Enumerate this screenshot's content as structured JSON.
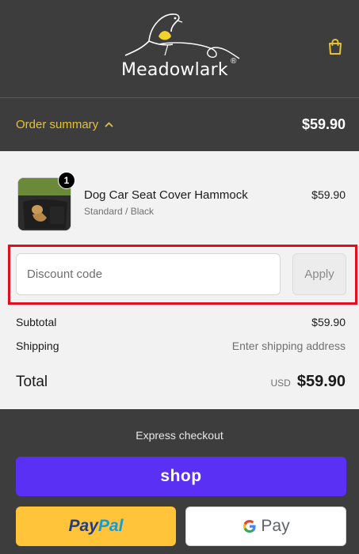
{
  "header": {
    "brand": "Meadowlark",
    "brand_mark": "®",
    "icons": {
      "cart": "shopping-bag-icon",
      "logo": "meadowlark-bird-logo"
    },
    "colors": {
      "accent": "#e6c233",
      "background": "#3d3d3d"
    }
  },
  "summary": {
    "toggle_label": "Order summary",
    "toggle_icon": "chevron-up-icon",
    "total": "$59.90"
  },
  "cart": {
    "items": [
      {
        "quantity": "1",
        "name": "Dog Car Seat Cover Hammock",
        "variant": "Standard / Black",
        "price": "$59.90"
      }
    ]
  },
  "discount": {
    "placeholder": "Discount code",
    "value": "",
    "apply_label": "Apply"
  },
  "totals": {
    "subtotal_label": "Subtotal",
    "subtotal_value": "$59.90",
    "shipping_label": "Shipping",
    "shipping_value": "Enter shipping address",
    "total_label": "Total",
    "currency": "USD",
    "total_value": "$59.90"
  },
  "express": {
    "label": "Express checkout",
    "shop_label": "shop",
    "paypal_part1": "Pay",
    "paypal_part2": "Pal",
    "gpay_label": "Pay",
    "colors": {
      "shop": "#5a31f4",
      "paypal": "#ffc439",
      "gpay": "#ffffff"
    }
  }
}
